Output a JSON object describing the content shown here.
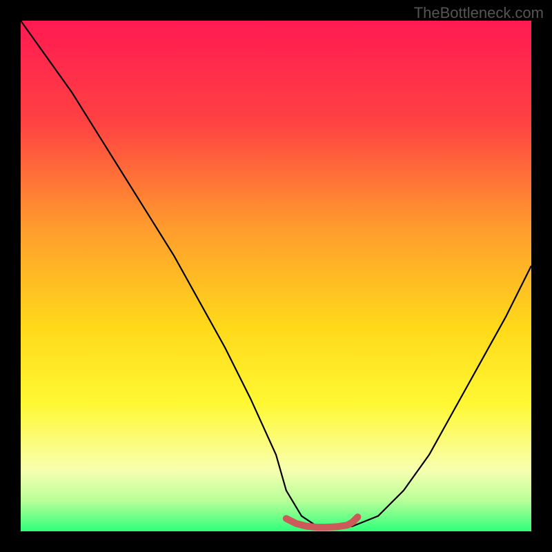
{
  "watermark": "TheBottleneck.com",
  "chart_data": {
    "type": "line",
    "title": "",
    "xlabel": "",
    "ylabel": "",
    "xlim": [
      0,
      100
    ],
    "ylim": [
      0,
      100
    ],
    "series": [
      {
        "name": "bottleneck-curve",
        "x": [
          0,
          5,
          10,
          15,
          20,
          25,
          30,
          35,
          40,
          45,
          50,
          52,
          55,
          58,
          60,
          62,
          65,
          70,
          75,
          80,
          85,
          90,
          95,
          100
        ],
        "y": [
          100,
          93,
          86,
          78,
          70,
          62,
          54,
          45,
          36,
          26,
          15,
          8,
          3,
          1,
          0.5,
          0.5,
          1,
          3,
          8,
          15,
          24,
          33,
          42,
          52
        ]
      },
      {
        "name": "optimal-zone-marker",
        "x": [
          52,
          54,
          56,
          58,
          60,
          62,
          64,
          65,
          66
        ],
        "y": [
          2.5,
          1.5,
          1.0,
          0.8,
          0.8,
          0.9,
          1.2,
          1.8,
          2.8
        ]
      }
    ],
    "gradient_stops": [
      {
        "offset": 0,
        "color": "#ff1a52"
      },
      {
        "offset": 20,
        "color": "#ff4242"
      },
      {
        "offset": 40,
        "color": "#ff9a2e"
      },
      {
        "offset": 60,
        "color": "#ffd91a"
      },
      {
        "offset": 75,
        "color": "#fff833"
      },
      {
        "offset": 88,
        "color": "#f8ffb0"
      },
      {
        "offset": 94,
        "color": "#b8ff99"
      },
      {
        "offset": 100,
        "color": "#2eff7a"
      }
    ]
  }
}
